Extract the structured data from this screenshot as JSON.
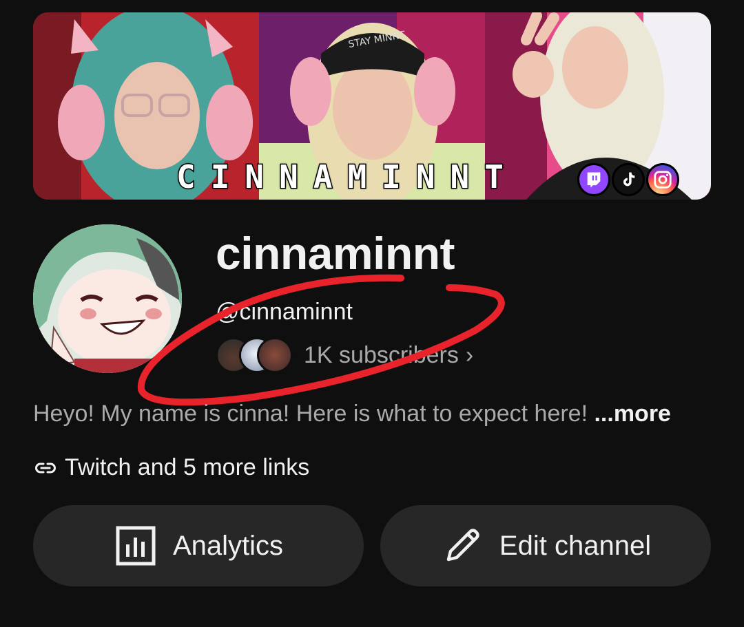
{
  "banner": {
    "text": "CINNAMINNT",
    "social_icons": [
      "twitch-icon",
      "tiktok-icon",
      "instagram-icon"
    ]
  },
  "channel": {
    "name": "cinnaminnt",
    "handle": "@cinnaminnt",
    "subscribers": "1K subscribers",
    "description": "Heyo! My name is cinna! Here is what to expect here!",
    "more_label": " ...more",
    "links_text": "Twitch and 5 more links"
  },
  "actions": {
    "analytics_label": "Analytics",
    "edit_label": "Edit channel"
  },
  "colors": {
    "background": "#0f0f0f",
    "button": "#272727",
    "secondary_text": "#aaaaaa",
    "annotation": "#e8232b"
  }
}
